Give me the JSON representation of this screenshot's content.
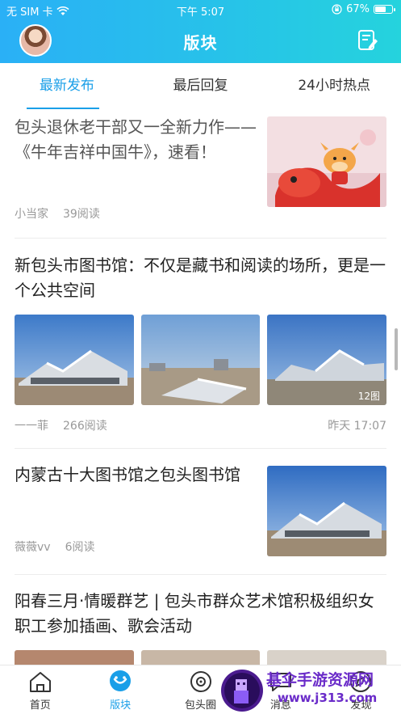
{
  "status_bar": {
    "carrier": "无 SIM 卡",
    "time": "下午 5:07",
    "battery": "67%",
    "battery_level": 0.67
  },
  "header": {
    "title": "版块"
  },
  "tabs": [
    {
      "label": "最新发布",
      "active": true
    },
    {
      "label": "最后回复",
      "active": false
    },
    {
      "label": "24小时热点",
      "active": false
    }
  ],
  "posts": [
    {
      "title": "包头退休老干部又一全新力作——《牛年吉祥中国牛》，速看！",
      "author": "小当家",
      "reads": "39阅读"
    },
    {
      "title": "新包头市图书馆：不仅是藏书和阅读的场所，更是一个公共空间",
      "author": "一一菲",
      "reads": "266阅读",
      "time": "昨天 17:07",
      "image_count": "12图"
    },
    {
      "title": "内蒙古十大图书馆之包头图书馆",
      "author": "薇薇vv",
      "reads": "6阅读"
    },
    {
      "title": "阳春三月·情暖群艺 | 包头市群众艺术馆积极组织女职工参加插画、歌会活动"
    }
  ],
  "bottom_nav": [
    {
      "label": "首页",
      "icon": "home-icon",
      "active": false
    },
    {
      "label": "版块",
      "icon": "board-icon",
      "active": true
    },
    {
      "label": "包头圈",
      "icon": "camera-circle-icon",
      "active": false
    },
    {
      "label": "消息",
      "icon": "message-icon",
      "active": false
    },
    {
      "label": "发现",
      "icon": "discover-icon",
      "active": false
    }
  ],
  "watermark": {
    "line1": "基伞手游资源网",
    "line2": "www.j313.com"
  },
  "colors": {
    "accent": "#1a9fe8",
    "header_start": "#2ab0f6",
    "header_end": "#25d3dd"
  }
}
